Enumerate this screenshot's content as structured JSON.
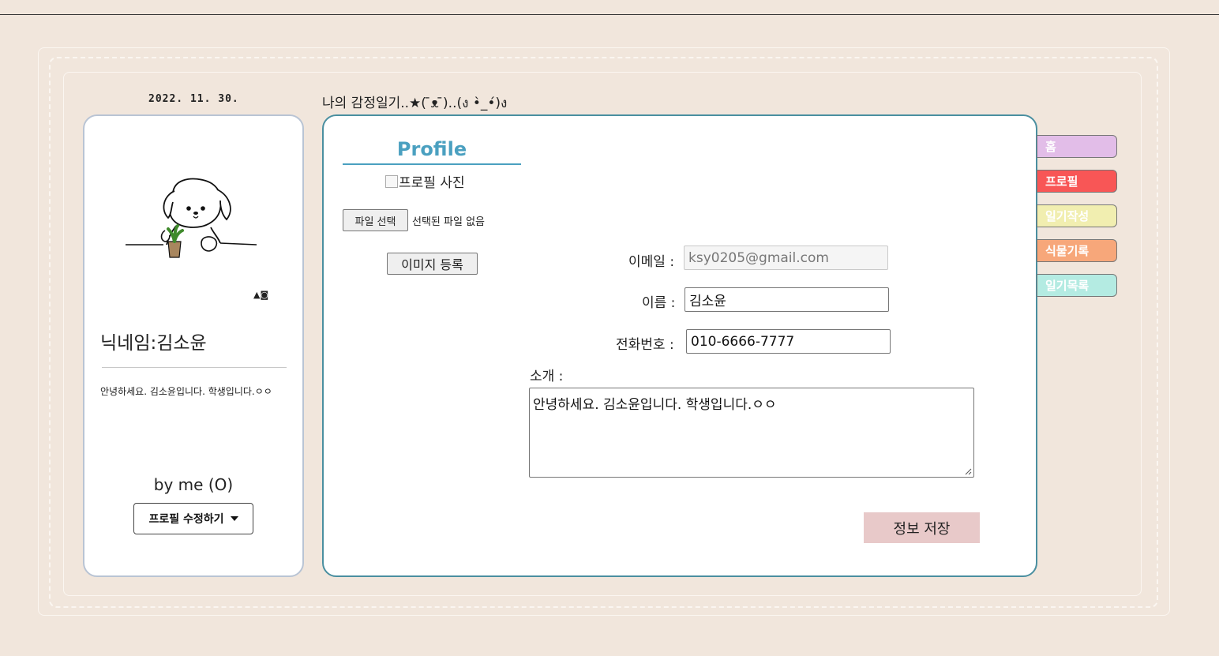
{
  "header": {
    "date": "2022. 11. 30.",
    "site_title": "나의 감정일기..★( ̄ᴥ ̄)..(ง •̀_•́)ง"
  },
  "left_card": {
    "small_icons": "▲◙",
    "nickname": "닉네임:김소윤",
    "intro": "안녕하세요. 김소윤입니다. 학생입니다.ㅇㅇ",
    "byline": "by me (O)",
    "edit_button": "프로필 수정하기"
  },
  "profile": {
    "title": "Profile",
    "image_alt": "프로필 사진",
    "file_button": "파일 선택",
    "file_status": "선택된 파일 없음",
    "image_register_button": "이미지 등록",
    "email_label": "이메일 :",
    "email_value": "ksy0205@gmail.com",
    "name_label": "이름 :",
    "name_value": "김소윤",
    "phone_label": "전화번호 :",
    "phone_value": "010-6666-7777",
    "intro_label": "소개 :",
    "intro_value": "안녕하세요. 김소윤입니다. 학생입니다.ㅇㅇ",
    "save_button": "정보 저장"
  },
  "side_tabs": [
    {
      "label": "홈",
      "color": "#e2bde8"
    },
    {
      "label": "프로필",
      "color": "#f85656"
    },
    {
      "label": "일기작성",
      "color": "#f1eeb0"
    },
    {
      "label": "식물기록",
      "color": "#f7a77a"
    },
    {
      "label": "일기목록",
      "color": "#b4ebe2"
    }
  ],
  "colors": {
    "background": "#f1e6dc",
    "profile_accent": "#4aa0c0",
    "save_button": "#e8c9c9"
  }
}
